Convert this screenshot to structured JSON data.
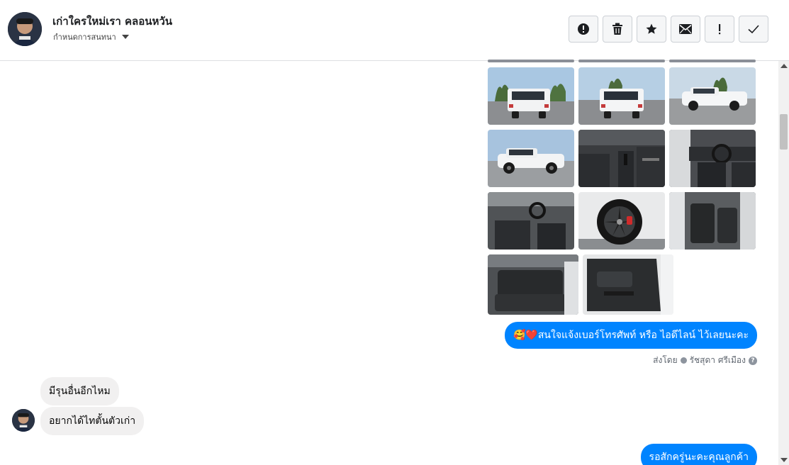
{
  "header": {
    "title": "เก่าใครใหม่เรา คลอนหวัน",
    "subtitle": "กำหนดการสนทนา",
    "avatar_icon": "profile-avatar"
  },
  "toolbar": {
    "buttons": [
      {
        "name": "report-spam-button",
        "icon": "alert-circle-icon"
      },
      {
        "name": "delete-button",
        "icon": "trash-icon"
      },
      {
        "name": "star-button",
        "icon": "star-icon"
      },
      {
        "name": "mark-unread-button",
        "icon": "envelope-icon"
      },
      {
        "name": "priority-button",
        "icon": "exclamation-icon"
      },
      {
        "name": "mark-done-button",
        "icon": "check-icon"
      }
    ]
  },
  "messages": {
    "outgoing_1": "สนใจแจ้งเบอร์โทรศัพท์ หรือ ไอดีไลน์  ไว้เลยนะคะ",
    "outgoing_1_emoji": "🥰❤️",
    "sent_by_label": "ส่งโดย",
    "sent_by_name": "รัชสุดา ศรีเมือง",
    "help_glyph": "?",
    "incoming_1": "มีรุนอื่นอีกไหม",
    "incoming_2": "อยากได้ไทตั้นตัวเก่า",
    "outgoing_2": "รอสักครู่นะคะคุณลูกค้า"
  },
  "colors": {
    "accent": "#0084ff",
    "incoming_bubble": "#f1f0f0",
    "border": "#ccd0d5"
  }
}
